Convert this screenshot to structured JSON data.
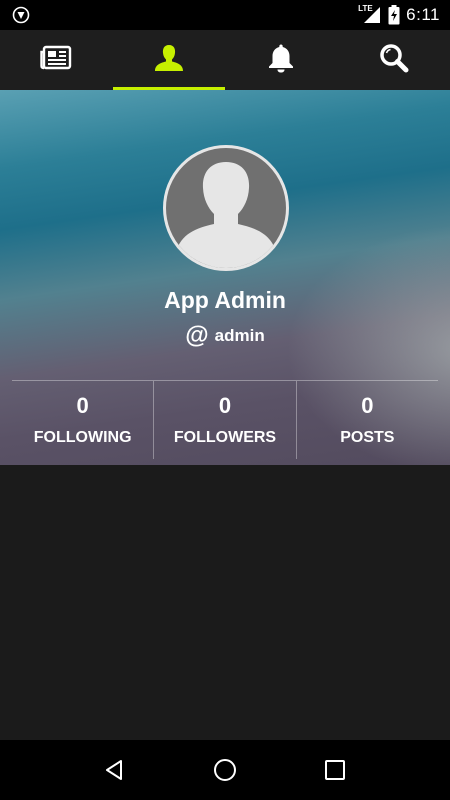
{
  "status_bar": {
    "time": "6:11",
    "network": "LTE",
    "icons": [
      "vpn-shield-icon",
      "signal-icon",
      "battery-charging-icon"
    ]
  },
  "top_nav": {
    "tabs": [
      {
        "icon": "newspaper-icon",
        "active": false
      },
      {
        "icon": "profile-icon",
        "active": true
      },
      {
        "icon": "bell-icon",
        "active": false
      },
      {
        "icon": "search-icon",
        "active": false
      }
    ],
    "accent_color": "#c6f000"
  },
  "profile": {
    "display_name": "App Admin",
    "at_symbol": "@",
    "username": "admin",
    "stats": [
      {
        "value": "0",
        "label": "FOLLOWING"
      },
      {
        "value": "0",
        "label": "FOLLOWERS"
      },
      {
        "value": "0",
        "label": "POSTS"
      }
    ]
  },
  "system_nav": {
    "buttons": [
      "back-icon",
      "home-icon",
      "recents-icon"
    ]
  }
}
